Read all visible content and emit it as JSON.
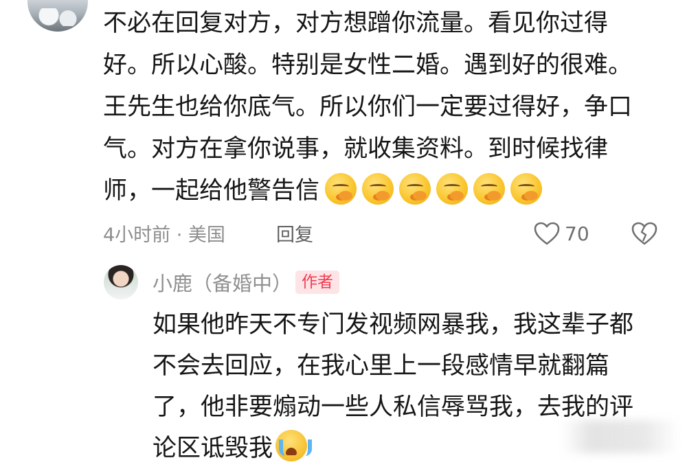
{
  "comment": {
    "lines": [
      "不必在回复对方，对方想蹭你流量。看见你过得",
      "好。所以心酸。特别是女性二婚。遇到好的很难。",
      "王先生也给你底气。所以你们一定要过得好，争口",
      "气。对方在拿你说事，就收集资料。到时候找律",
      "师，一起给他警告信"
    ],
    "emoji_count": 6,
    "emoji_name": "shushing-face-emoji",
    "meta": "4小时前 · 美国",
    "reply_label": "回复",
    "like_count": "70"
  },
  "reply": {
    "name": "小鹿（备婚中）",
    "badge": "作者",
    "lines": [
      "如果他昨天不专门发视频网暴我，我这辈子都",
      "不会去回应，在我心里上一段感情早就翻篇",
      "了，他非要煽动一些人私信辱骂我，去我的评",
      "论区诋毁我"
    ],
    "emoji_name": "crying-face-emoji"
  },
  "colors": {
    "badge_bg": "#fde4e6",
    "badge_text": "#f23b50",
    "meta_text": "#8d8d8d"
  }
}
